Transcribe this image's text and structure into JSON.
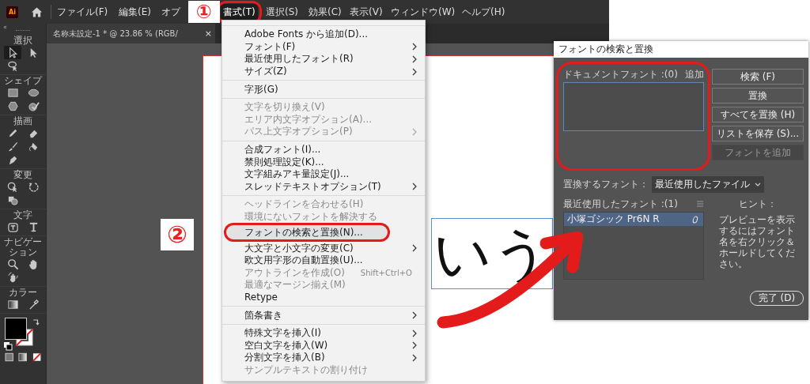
{
  "menubar": {
    "logo": "Ai",
    "items": [
      {
        "label": "ファイル(F)",
        "selected": false
      },
      {
        "label": "編集(E)",
        "selected": false
      },
      {
        "label": "オプ",
        "selected": false
      },
      {
        "label": "書式(T)",
        "selected": true
      },
      {
        "label": "選択(S)",
        "selected": false
      },
      {
        "label": "効果(C)",
        "selected": false
      },
      {
        "label": "表示(V)",
        "selected": false
      },
      {
        "label": "ウィンドウ(W)",
        "selected": false
      },
      {
        "label": "ヘルプ(H)",
        "selected": false
      }
    ]
  },
  "toolbar": {
    "collapse": "«",
    "groups": [
      {
        "label": "選択",
        "tools": [
          {
            "kind": "select",
            "selected": true
          },
          {
            "kind": "direct",
            "selected": false
          },
          {
            "kind": "lasso",
            "selected": false
          }
        ]
      },
      {
        "label": "シェイプ",
        "tools": [
          {
            "kind": "rect",
            "selected": false
          },
          {
            "kind": "ellipse",
            "selected": false
          },
          {
            "kind": "polygon",
            "selected": false
          },
          {
            "kind": "shaper",
            "selected": false
          }
        ]
      },
      {
        "label": "描画",
        "tools": [
          {
            "kind": "pencil",
            "selected": false
          },
          {
            "kind": "eraser",
            "selected": false
          },
          {
            "kind": "brush",
            "selected": false
          },
          {
            "kind": "blob",
            "selected": false
          },
          {
            "kind": "pen",
            "selected": false
          }
        ]
      },
      {
        "label": "変更",
        "tools": [
          {
            "kind": "transform",
            "selected": false
          },
          {
            "kind": "rotate",
            "selected": false
          },
          {
            "kind": "builder",
            "selected": false
          }
        ]
      },
      {
        "label": "文字",
        "tools": [
          {
            "kind": "touchtype",
            "selected": false
          },
          {
            "kind": "type",
            "selected": false
          }
        ]
      },
      {
        "label": "ナビゲーション",
        "tools": [
          {
            "kind": "zoom",
            "selected": false
          },
          {
            "kind": "hand",
            "selected": false
          },
          {
            "kind": "rotateview",
            "selected": false
          }
        ]
      },
      {
        "label": "カラー",
        "tools": [
          {
            "kind": "gradient",
            "selected": false
          },
          {
            "kind": "eyedropper",
            "selected": false
          }
        ]
      }
    ]
  },
  "document_tab": {
    "title": "名称未設定-1 * @ 23.86 % (RGB/",
    "close": "×"
  },
  "artboard": {
    "text": "いう",
    "selected": true
  },
  "type_menu": {
    "groups": [
      {
        "items": [
          {
            "label": "Adobe Fonts から追加(D)...",
            "disabled": false,
            "submenu": false,
            "selected": false
          },
          {
            "label": "フォント(F)",
            "disabled": false,
            "submenu": true,
            "selected": false
          },
          {
            "label": "最近使用したフォント(R)",
            "disabled": false,
            "submenu": true,
            "selected": false
          },
          {
            "label": "サイズ(Z)",
            "disabled": false,
            "submenu": true,
            "selected": false
          }
        ]
      },
      {
        "items": [
          {
            "label": "字形(G)",
            "disabled": false,
            "submenu": false,
            "selected": false
          }
        ]
      },
      {
        "items": [
          {
            "label": "文字を切り換え(V)",
            "disabled": true,
            "submenu": false,
            "selected": false
          },
          {
            "label": "エリア内文字オプション(A)...",
            "disabled": true,
            "submenu": false,
            "selected": false
          },
          {
            "label": "パス上文字オプション(P)",
            "disabled": true,
            "submenu": true,
            "selected": false
          }
        ]
      },
      {
        "items": [
          {
            "label": "合成フォント(I)...",
            "disabled": false,
            "submenu": false,
            "selected": false
          },
          {
            "label": "禁則処理設定(K)...",
            "disabled": false,
            "submenu": false,
            "selected": false
          },
          {
            "label": "文字組みアキ量設定(J)...",
            "disabled": false,
            "submenu": false,
            "selected": false
          },
          {
            "label": "スレッドテキストオプション(T)",
            "disabled": false,
            "submenu": true,
            "selected": false
          }
        ]
      },
      {
        "items": [
          {
            "label": "ヘッドラインを合わせる(H)",
            "disabled": true,
            "submenu": false,
            "selected": false
          },
          {
            "label": "環境にないフォントを解決する",
            "disabled": true,
            "submenu": false,
            "selected": false
          },
          {
            "label": "フォントの検索と置換(N)...",
            "disabled": false,
            "submenu": false,
            "selected": true
          },
          {
            "label": "大文字と小文字の変更(C)",
            "disabled": false,
            "submenu": true,
            "selected": false
          },
          {
            "label": "欧文用字形の自動置換(U)...",
            "disabled": false,
            "submenu": false,
            "selected": false
          },
          {
            "label": "アウトラインを作成(O)",
            "shortcut": "Shift+Ctrl+O",
            "disabled": true,
            "submenu": false,
            "selected": false
          },
          {
            "label": "最適なマージン揃え(M)",
            "disabled": true,
            "submenu": false,
            "selected": false
          },
          {
            "label": "Retype",
            "disabled": false,
            "submenu": false,
            "selected": false
          }
        ]
      },
      {
        "items": [
          {
            "label": "箇条書き",
            "disabled": false,
            "submenu": true,
            "selected": false
          }
        ]
      },
      {
        "items": [
          {
            "label": "特殊文字を挿入(I)",
            "disabled": false,
            "submenu": true,
            "selected": false
          },
          {
            "label": "空白文字を挿入(W)",
            "disabled": false,
            "submenu": true,
            "selected": false
          },
          {
            "label": "分割文字を挿入(B)",
            "disabled": false,
            "submenu": true,
            "selected": false
          },
          {
            "label": "サンプルテキストの割り付け",
            "disabled": true,
            "submenu": false,
            "selected": false
          }
        ]
      }
    ]
  },
  "dialog": {
    "title": "フォントの検索と置換",
    "document_fonts": {
      "label": "ドキュメントフォント :(0)",
      "add": "追加"
    },
    "replace_with": {
      "label": "置換するフォント：",
      "value": "最近使用したファイル"
    },
    "recent_fonts": {
      "label": "最近使用したフォント :(1)",
      "items": [
        {
          "name": "小塚ゴシック Pr6N R",
          "selected": true
        }
      ]
    },
    "buttons": [
      {
        "label": "検索 (F)",
        "disabled": false
      },
      {
        "label": "置換",
        "disabled": false
      },
      {
        "label": "すべてを置換 (H)",
        "disabled": false
      },
      {
        "label": "リストを保存 (S)...",
        "disabled": false
      },
      {
        "label": "フォントを追加",
        "disabled": true
      }
    ],
    "hint_title": "ヒント：",
    "hint": "プレビューを表示するにはフォント名を右クリック＆ホールドしてください。",
    "done": "完了 (D)"
  },
  "annotations": {
    "steps": [
      {
        "label": "①"
      },
      {
        "label": "②"
      }
    ]
  }
}
